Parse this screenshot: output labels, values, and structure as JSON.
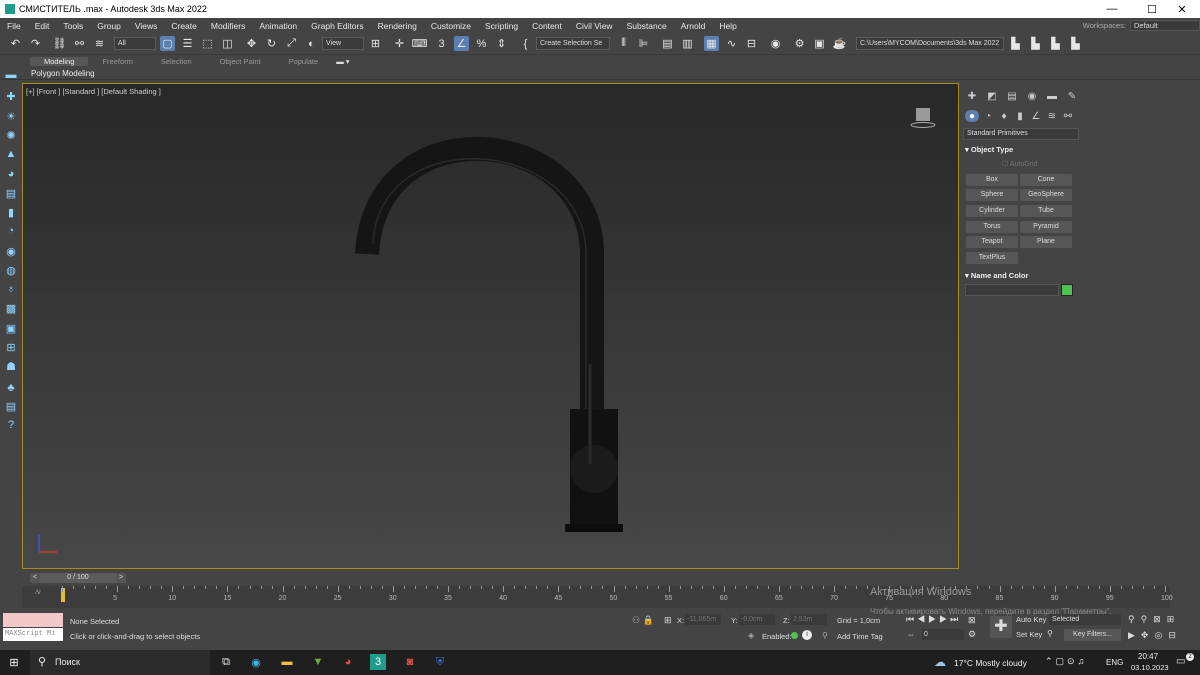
{
  "window": {
    "title": "СМИСТИТЕЛЬ .max - Autodesk 3ds Max 2022",
    "min": "—",
    "max": "☐",
    "close": "✕"
  },
  "menu": [
    "File",
    "Edit",
    "Tools",
    "Group",
    "Views",
    "Create",
    "Modifiers",
    "Animation",
    "Graph Editors",
    "Rendering",
    "Customize",
    "Scripting",
    "Content",
    "Civil View",
    "Substance",
    "Arnold",
    "Help"
  ],
  "workspaces": {
    "label": "Workspaces:",
    "value": "Default"
  },
  "toolbar": {
    "filter": "All",
    "refcoord": "View",
    "selset": "Create Selection Se",
    "path": "C:\\Users\\MYCOM\\Documents\\3ds Max 2022"
  },
  "ribbon": {
    "tabs": [
      "Modeling",
      "Freeform",
      "Selection",
      "Object Paint",
      "Populate"
    ],
    "sub": "Polygon Modeling"
  },
  "viewport": {
    "label": "[+] [Front ] [Standard ] [Default Shading ]"
  },
  "cmd": {
    "category": "Standard Primitives",
    "object_type": "Object Type",
    "autogrid": "AutoGrid",
    "buttons": [
      "Box",
      "Cone",
      "Sphere",
      "GeoSphere",
      "Cylinder",
      "Tube",
      "Torus",
      "Pyramid",
      "Teapot",
      "Plane",
      "TextPlus"
    ],
    "name_color": "Name and Color",
    "swatch_color": "#4fc24f"
  },
  "timeline": {
    "frame": "0 / 100",
    "ticks": [
      "5",
      "10",
      "15",
      "20",
      "25",
      "30",
      "35",
      "40",
      "45",
      "50",
      "55",
      "60",
      "65",
      "70",
      "75",
      "80",
      "85",
      "90",
      "95",
      "100"
    ]
  },
  "status": {
    "script": "MAXScript Mi",
    "selected": "None Selected",
    "hint": "Click or click-and-drag to select objects",
    "x": "X:",
    "xv": "-11,065m",
    "y": "Y:",
    "yv": "-0,0cm",
    "z": "Z:",
    "zv": "2,53m",
    "grid": "Grid = 1,0cm",
    "enabled": "Enabled:",
    "addtime": "Add Time Tag",
    "autokey": "Auto Key",
    "selected_dd": "Selected",
    "setkey": "Set Key",
    "keyfilters": "Key Filters...",
    "frame_field": "0",
    "activation1": "Активация Windows",
    "activation2": "Чтобы активировать Windows, перейдите в раздел \"Параметры\"."
  },
  "taskbar": {
    "search": "Поиск",
    "weather": "17°C  Mostly cloudy",
    "lang": "ENG",
    "time": "20:47",
    "date": "03.10.2023",
    "notif": "2"
  }
}
